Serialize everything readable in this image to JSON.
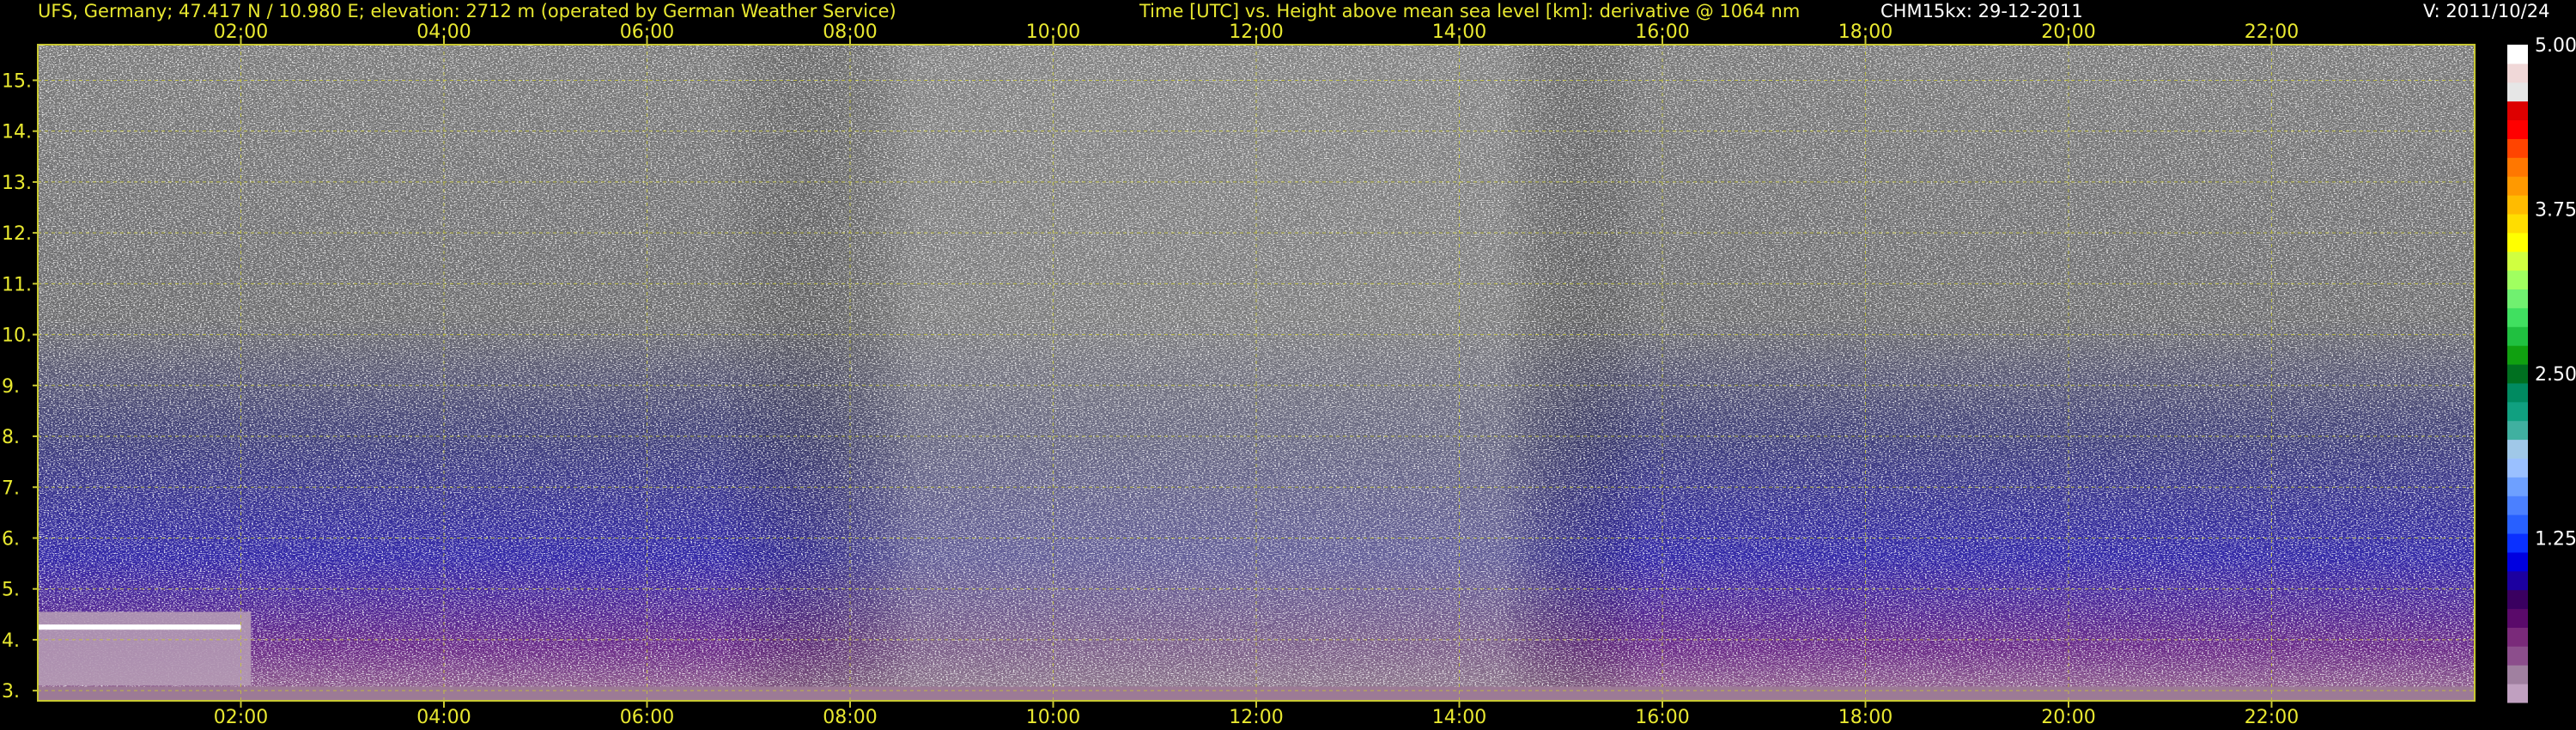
{
  "header": {
    "station": "UFS, Germany; 47.417 N / 10.980 E; elevation: 2712 m  (operated by German Weather Service)",
    "plot_description": "Time [UTC] vs. Height above mean sea level [km]: derivative @ 1064 nm",
    "instrument_date": "CHM15kx: 29-12-2011",
    "version": "V: 2011/10/24"
  },
  "colors": {
    "text_yellow": "#e8e830",
    "text_white": "#ffffff",
    "grid": "#c8c832",
    "background": "#000000"
  },
  "chart_data": {
    "type": "heatmap",
    "x_ticks": [
      "02:00",
      "04:00",
      "06:00",
      "08:00",
      "10:00",
      "12:00",
      "14:00",
      "16:00",
      "18:00",
      "20:00",
      "22:00"
    ],
    "y_ticks": [
      "3.",
      "4.",
      "5.",
      "6.",
      "7.",
      "8.",
      "9.",
      "10.",
      "11.",
      "12.",
      "13.",
      "14.",
      "15."
    ],
    "xlim_hours": [
      0,
      24
    ],
    "ylim_km": [
      2.8,
      15.7
    ],
    "grid": true,
    "colorbar": {
      "ticks": [
        "5.00",
        "3.75",
        "2.50",
        "1.25"
      ],
      "range": [
        0,
        5
      ],
      "colors": [
        "#c0a0c0",
        "#a080a0",
        "#8c4e8c",
        "#7a2a7a",
        "#5a0a6a",
        "#3a0060",
        "#1c00a0",
        "#0000e0",
        "#0a30ff",
        "#2860ff",
        "#4b80ff",
        "#6ea0ff",
        "#9ac0ff",
        "#a0c8e8",
        "#40b0a0",
        "#10a080",
        "#008a60",
        "#007020",
        "#10a010",
        "#20c040",
        "#40e060",
        "#70f070",
        "#a0ff60",
        "#d0ff40",
        "#ffff00",
        "#ffdd00",
        "#ffbb00",
        "#ff9900",
        "#ff7700",
        "#ff4400",
        "#ff0000",
        "#dd0000",
        "#e6e6e6",
        "#f0d8d8",
        "#ffffff"
      ]
    }
  }
}
